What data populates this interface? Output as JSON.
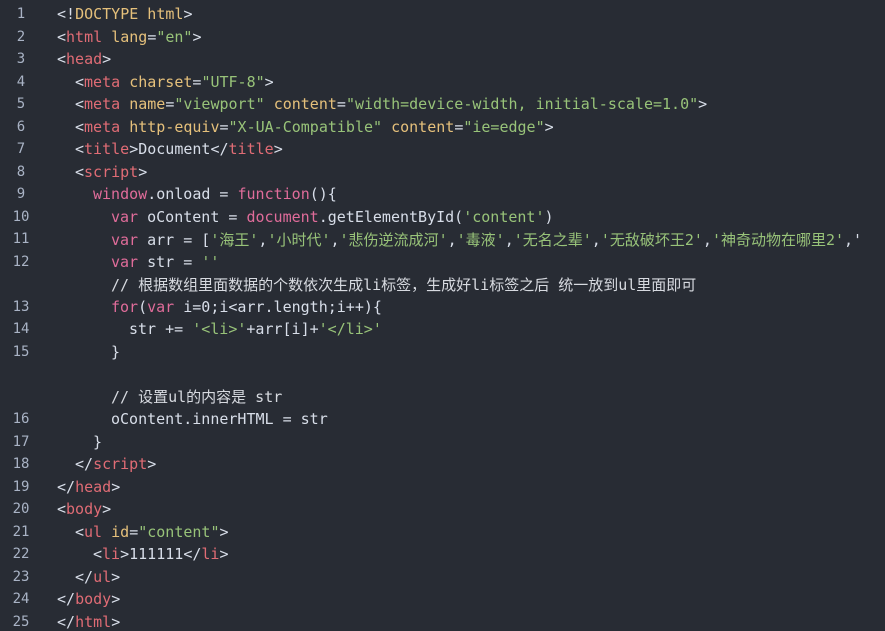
{
  "lines": [
    {
      "num": "1",
      "indent": 0,
      "tokens": [
        [
          "punc",
          "<!"
        ],
        [
          "attr",
          "DOCTYPE html"
        ],
        [
          "punc",
          ">"
        ]
      ]
    },
    {
      "num": "2",
      "indent": 0,
      "tokens": [
        [
          "punc",
          "<"
        ],
        [
          "tag",
          "html"
        ],
        [
          "plain",
          " "
        ],
        [
          "attr",
          "lang"
        ],
        [
          "punc",
          "="
        ],
        [
          "str",
          "\"en\""
        ],
        [
          "punc",
          ">"
        ]
      ]
    },
    {
      "num": "3",
      "indent": 0,
      "tokens": [
        [
          "punc",
          "<"
        ],
        [
          "tag",
          "head"
        ],
        [
          "punc",
          ">"
        ]
      ]
    },
    {
      "num": "4",
      "indent": 1,
      "tokens": [
        [
          "punc",
          "<"
        ],
        [
          "tag",
          "meta"
        ],
        [
          "plain",
          " "
        ],
        [
          "attr",
          "charset"
        ],
        [
          "punc",
          "="
        ],
        [
          "str",
          "\"UTF-8\""
        ],
        [
          "punc",
          ">"
        ]
      ]
    },
    {
      "num": "5",
      "indent": 1,
      "tokens": [
        [
          "punc",
          "<"
        ],
        [
          "tag",
          "meta"
        ],
        [
          "plain",
          " "
        ],
        [
          "attr",
          "name"
        ],
        [
          "punc",
          "="
        ],
        [
          "str",
          "\"viewport\""
        ],
        [
          "plain",
          " "
        ],
        [
          "attr",
          "content"
        ],
        [
          "punc",
          "="
        ],
        [
          "str",
          "\"width=device-width, initial-scale=1.0\""
        ],
        [
          "punc",
          ">"
        ]
      ]
    },
    {
      "num": "6",
      "indent": 1,
      "tokens": [
        [
          "punc",
          "<"
        ],
        [
          "tag",
          "meta"
        ],
        [
          "plain",
          " "
        ],
        [
          "attr",
          "http-equiv"
        ],
        [
          "punc",
          "="
        ],
        [
          "str",
          "\"X-UA-Compatible\""
        ],
        [
          "plain",
          " "
        ],
        [
          "attr",
          "content"
        ],
        [
          "punc",
          "="
        ],
        [
          "str",
          "\"ie=edge\""
        ],
        [
          "punc",
          ">"
        ]
      ]
    },
    {
      "num": "7",
      "indent": 1,
      "tokens": [
        [
          "punc",
          "<"
        ],
        [
          "tag",
          "title"
        ],
        [
          "punc",
          ">"
        ],
        [
          "plain",
          "Document"
        ],
        [
          "punc",
          "</"
        ],
        [
          "tag",
          "title"
        ],
        [
          "punc",
          ">"
        ]
      ]
    },
    {
      "num": "8",
      "indent": 1,
      "tokens": [
        [
          "punc",
          "<"
        ],
        [
          "tag",
          "script"
        ],
        [
          "punc",
          ">"
        ]
      ]
    },
    {
      "num": "9",
      "indent": 2,
      "tokens": [
        [
          "kw",
          "window"
        ],
        [
          "plain",
          ".onload = "
        ],
        [
          "kw",
          "function"
        ],
        [
          "punc",
          "(){"
        ]
      ]
    },
    {
      "num": "10",
      "indent": 3,
      "tokens": [
        [
          "kw",
          "var"
        ],
        [
          "plain",
          " oContent = "
        ],
        [
          "kw",
          "document"
        ],
        [
          "plain",
          ".getElementById("
        ],
        [
          "str",
          "'content'"
        ],
        [
          "plain",
          ")"
        ]
      ]
    },
    {
      "num": "11",
      "indent": 3,
      "tokens": [
        [
          "kw",
          "var"
        ],
        [
          "plain",
          " arr = ["
        ],
        [
          "str",
          "'海王'"
        ],
        [
          "plain",
          ","
        ],
        [
          "str",
          "'小时代'"
        ],
        [
          "plain",
          ","
        ],
        [
          "str",
          "'悲伤逆流成河'"
        ],
        [
          "plain",
          ","
        ],
        [
          "str",
          "'毒液'"
        ],
        [
          "plain",
          ","
        ],
        [
          "str",
          "'无名之辈'"
        ],
        [
          "plain",
          ","
        ],
        [
          "str",
          "'无敌破坏王2'"
        ],
        [
          "plain",
          ","
        ],
        [
          "str",
          "'神奇动物在哪里2'"
        ],
        [
          "plain",
          ",'"
        ]
      ]
    },
    {
      "num": "12",
      "indent": 3,
      "tokens": [
        [
          "kw",
          "var"
        ],
        [
          "plain",
          " str = "
        ],
        [
          "str",
          "''"
        ]
      ]
    },
    {
      "num": "",
      "indent": 3,
      "tokens": [
        [
          "com",
          "// 根据数组里面数据的个数依次生成li标签，生成好li标签之后 统一放到ul里面即可"
        ]
      ]
    },
    {
      "num": "13",
      "indent": 3,
      "tokens": [
        [
          "kw",
          "for"
        ],
        [
          "plain",
          "("
        ],
        [
          "kw",
          "var"
        ],
        [
          "plain",
          " i=0;i<arr.length;i++){"
        ]
      ]
    },
    {
      "num": "14",
      "indent": 4,
      "tokens": [
        [
          "plain",
          "str += "
        ],
        [
          "str",
          "'<li>'"
        ],
        [
          "plain",
          "+arr[i]+"
        ],
        [
          "str",
          "'</li>'"
        ]
      ]
    },
    {
      "num": "15",
      "indent": 3,
      "tokens": [
        [
          "plain",
          "}"
        ]
      ]
    },
    {
      "num": "",
      "indent": 3,
      "tokens": []
    },
    {
      "num": "",
      "indent": 3,
      "tokens": [
        [
          "com",
          "// 设置ul的内容是 str"
        ]
      ]
    },
    {
      "num": "16",
      "indent": 3,
      "tokens": [
        [
          "plain",
          "oContent.innerHTML = str"
        ]
      ]
    },
    {
      "num": "17",
      "indent": 2,
      "tokens": [
        [
          "plain",
          "}"
        ]
      ]
    },
    {
      "num": "18",
      "indent": 1,
      "tokens": [
        [
          "punc",
          "</"
        ],
        [
          "tag",
          "script"
        ],
        [
          "punc",
          ">"
        ]
      ]
    },
    {
      "num": "19",
      "indent": 0,
      "tokens": [
        [
          "punc",
          "</"
        ],
        [
          "tag",
          "head"
        ],
        [
          "punc",
          ">"
        ]
      ]
    },
    {
      "num": "20",
      "indent": 0,
      "tokens": [
        [
          "punc",
          "<"
        ],
        [
          "tag",
          "body"
        ],
        [
          "punc",
          ">"
        ]
      ]
    },
    {
      "num": "21",
      "indent": 1,
      "tokens": [
        [
          "punc",
          "<"
        ],
        [
          "tag",
          "ul"
        ],
        [
          "plain",
          " "
        ],
        [
          "attr",
          "id"
        ],
        [
          "punc",
          "="
        ],
        [
          "str",
          "\"content\""
        ],
        [
          "punc",
          ">"
        ]
      ]
    },
    {
      "num": "22",
      "indent": 2,
      "tokens": [
        [
          "punc",
          "<"
        ],
        [
          "tag",
          "li"
        ],
        [
          "punc",
          ">"
        ],
        [
          "plain",
          "111111"
        ],
        [
          "punc",
          "</"
        ],
        [
          "tag",
          "li"
        ],
        [
          "punc",
          ">"
        ]
      ]
    },
    {
      "num": "23",
      "indent": 1,
      "tokens": [
        [
          "punc",
          "</"
        ],
        [
          "tag",
          "ul"
        ],
        [
          "punc",
          ">"
        ]
      ]
    },
    {
      "num": "24",
      "indent": 0,
      "tokens": [
        [
          "punc",
          "</"
        ],
        [
          "tag",
          "body"
        ],
        [
          "punc",
          ">"
        ]
      ]
    },
    {
      "num": "25",
      "indent": 0,
      "tokens": [
        [
          "punc",
          "</"
        ],
        [
          "tag",
          "html"
        ],
        [
          "punc",
          ">"
        ]
      ]
    }
  ]
}
